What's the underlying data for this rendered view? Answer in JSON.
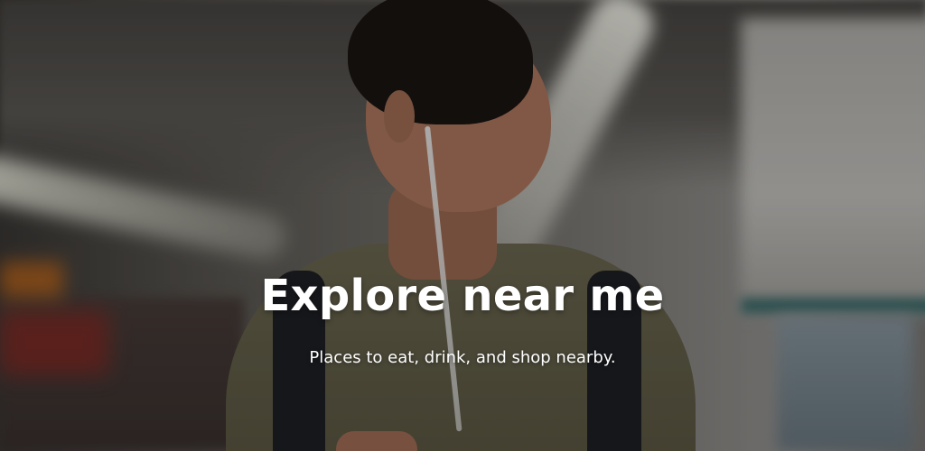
{
  "hero": {
    "title": "Explore near me",
    "subtitle": "Places to eat, drink, and shop nearby."
  },
  "colors": {
    "text": "#ffffff",
    "overlay": "rgba(0,0,0,0.28)"
  }
}
